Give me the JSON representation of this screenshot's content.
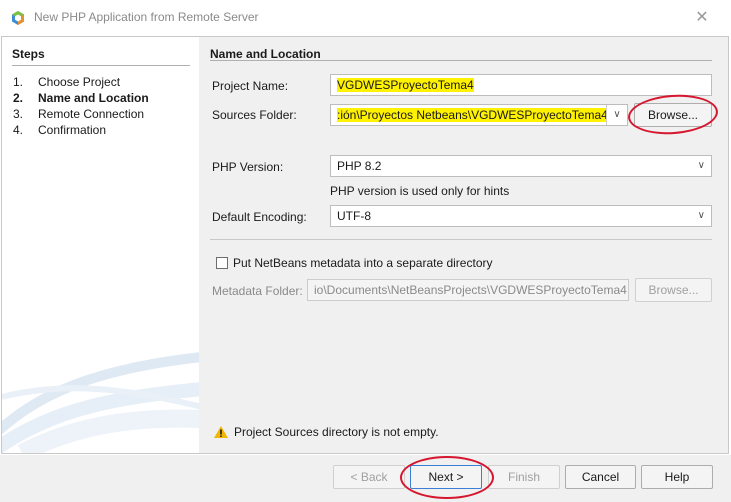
{
  "window": {
    "title": "New PHP Application from Remote Server",
    "close_glyph": "✕"
  },
  "steps": {
    "title": "Steps",
    "items": [
      {
        "num": "1.",
        "label": "Choose Project"
      },
      {
        "num": "2.",
        "label": "Name and Location"
      },
      {
        "num": "3.",
        "label": "Remote Connection"
      },
      {
        "num": "4.",
        "label": "Confirmation"
      }
    ],
    "active_index": 1
  },
  "form": {
    "section_title": "Name and Location",
    "project_name_label": "Project Name:",
    "project_name_value": "VGDWESProyectoTema4",
    "sources_folder_label": "Sources Folder:",
    "sources_folder_value": ":ión\\Proyectos Netbeans\\VGDWESProyectoTema4",
    "browse_label": "Browse...",
    "php_version_label": "PHP Version:",
    "php_version_value": "PHP 8.2",
    "php_version_hint": "PHP version is used only for hints",
    "encoding_label": "Default Encoding:",
    "encoding_value": "UTF-8",
    "metadata_checkbox_label": "Put NetBeans metadata into a separate directory",
    "metadata_checked": false,
    "metadata_folder_label": "Metadata Folder:",
    "metadata_folder_value": "io\\Documents\\NetBeansProjects\\VGDWESProyectoTema4",
    "metadata_browse_label": "Browse...",
    "warning_text": "Project Sources directory is not empty."
  },
  "footer": {
    "back_label": "< Back",
    "next_label": "Next >",
    "finish_label": "Finish",
    "cancel_label": "Cancel",
    "help_label": "Help"
  },
  "colors": {
    "highlight": "#fff200",
    "annotation_circle": "#d6162e",
    "warning": "#f2b705"
  },
  "icons": {
    "app": "netbeans-cube-icon",
    "close": "close-icon",
    "dropdown": "chevron-down-icon",
    "warning": "warning-icon"
  }
}
